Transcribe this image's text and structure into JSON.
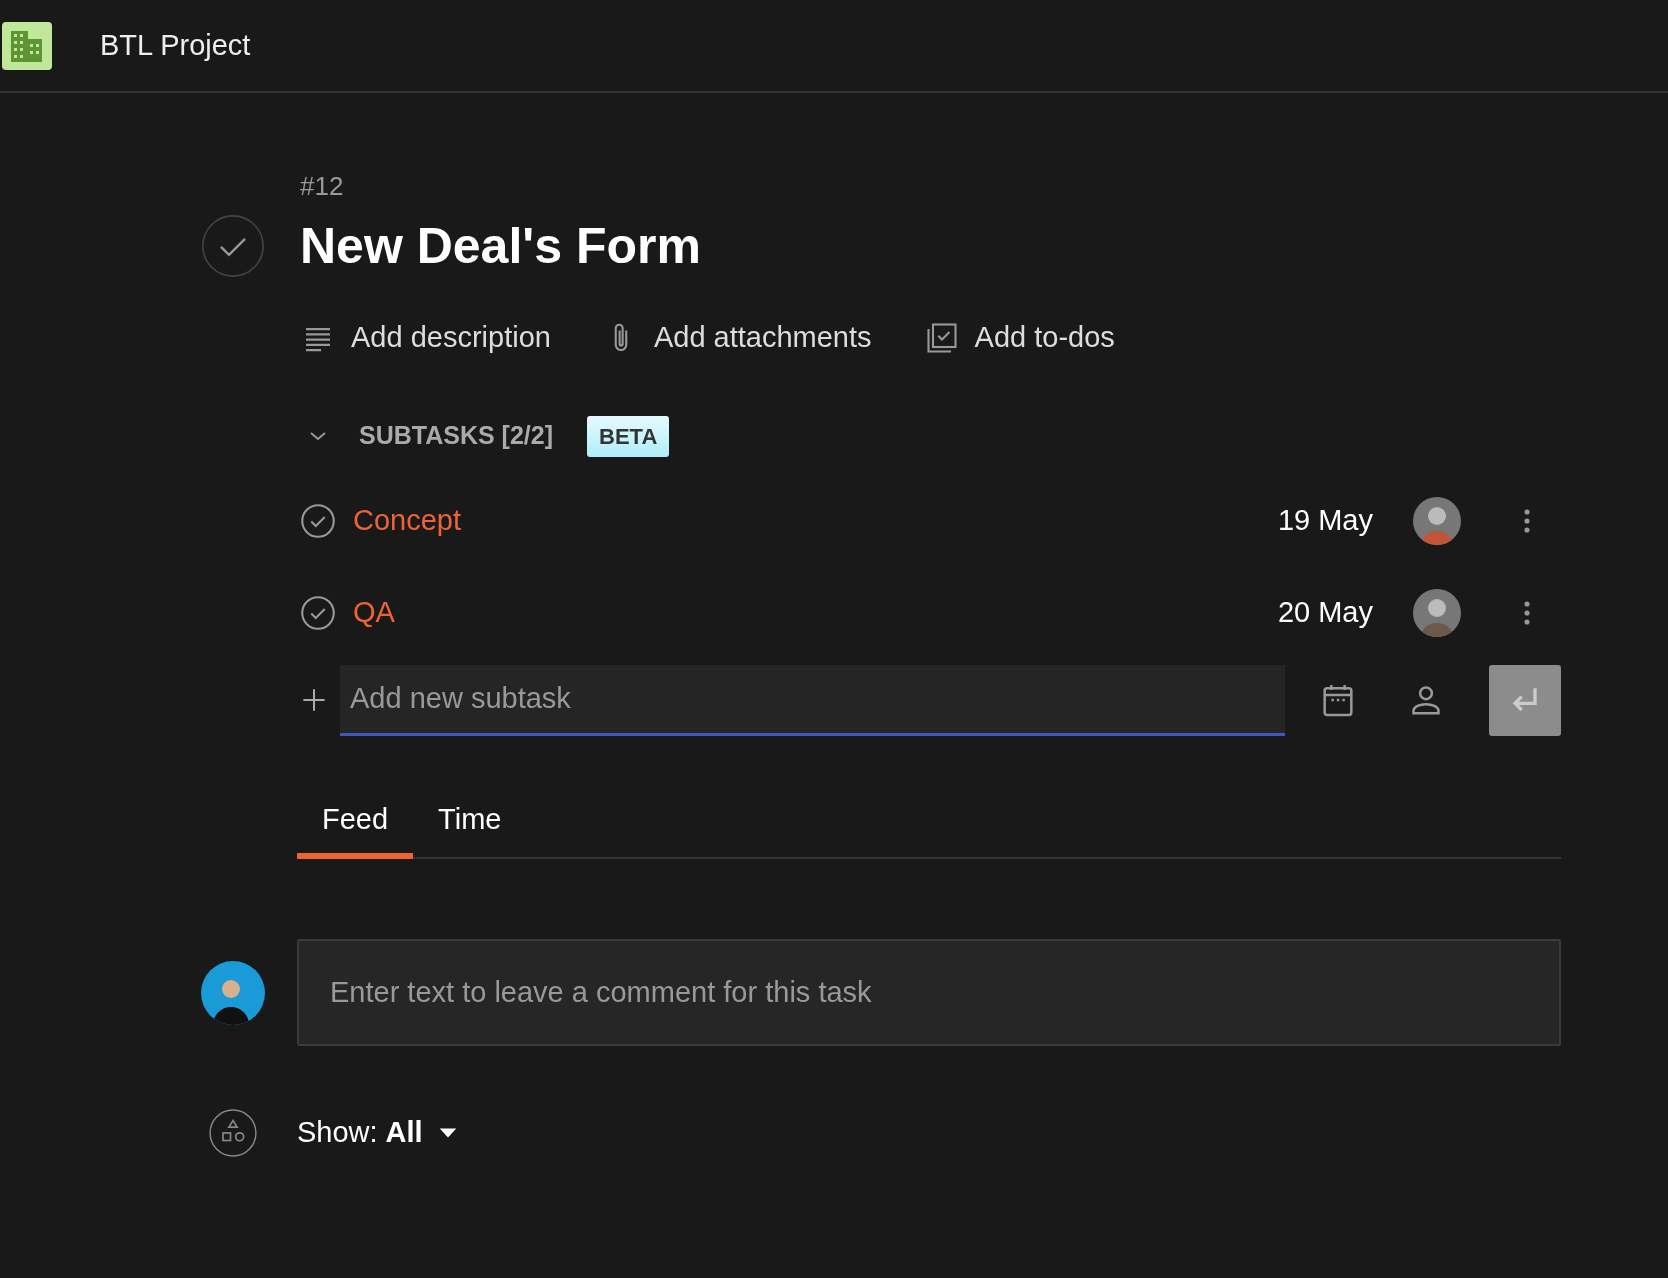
{
  "header": {
    "project": "BTL Project"
  },
  "task": {
    "number": "#12",
    "title": "New Deal's Form",
    "completed": true
  },
  "actions": [
    {
      "kind": "description",
      "label": "Add description"
    },
    {
      "kind": "attachments",
      "label": "Add attachments"
    },
    {
      "kind": "todos",
      "label": "Add to-dos"
    }
  ],
  "subtasks": {
    "heading": "SUBTASKS [2/2]",
    "badge": "BETA",
    "expanded": true,
    "items": [
      {
        "title": "Concept",
        "done": true,
        "date": "19 May"
      },
      {
        "title": "QA",
        "done": true,
        "date": "20 May"
      }
    ],
    "new_placeholder": "Add new subtask"
  },
  "tabs": [
    {
      "label": "Feed",
      "selected": true
    },
    {
      "label": "Time",
      "selected": false
    }
  ],
  "comment": {
    "placeholder": "Enter text to leave a comment for this task"
  },
  "filter": {
    "label": "Show:",
    "value": "All"
  }
}
